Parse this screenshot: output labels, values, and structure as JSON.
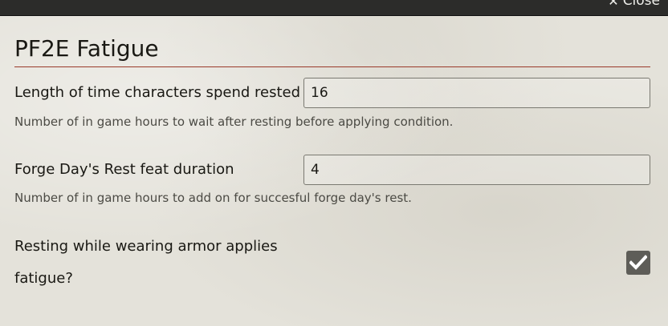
{
  "header": {
    "close_label": "Close",
    "close_icon": "close-icon"
  },
  "title": "PF2E Fatigue",
  "settings": [
    {
      "label": "Length of time characters spend rested",
      "value": "16",
      "hint": "Number of in game hours to wait after resting before applying condition."
    },
    {
      "label": "Forge Day's Rest feat duration",
      "value": "4",
      "hint": "Number of in game hours to add on for succesful forge day's rest."
    }
  ],
  "armor_setting": {
    "label_line1": "Resting while wearing armor applies",
    "label_line2": "fatigue?",
    "checked": true
  },
  "colors": {
    "accent_rule": "#9a3a2a",
    "checkbox_bg": "#5e5d58"
  }
}
